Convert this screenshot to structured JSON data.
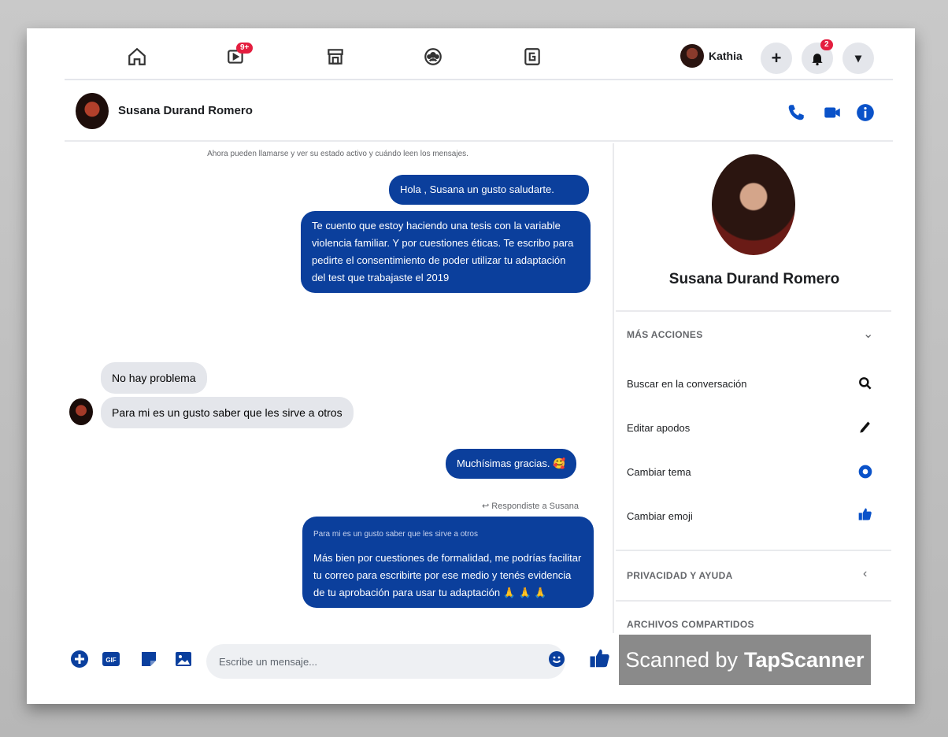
{
  "topnav": {
    "items": [
      {
        "icon": "home-icon"
      },
      {
        "icon": "watch-video-icon",
        "badge": "9+"
      },
      {
        "icon": "marketplace-icon"
      },
      {
        "icon": "groups-icon"
      },
      {
        "icon": "gaming-icon"
      }
    ],
    "user_name": "Kathia",
    "create_label": "+",
    "notifications_badge": "2",
    "menu_label": "▾"
  },
  "conversation": {
    "contact_name": "Susana Durand Romero",
    "system_note": "Ahora pueden llamarse y ver su estado activo y cuándo leen los mensajes.",
    "messages": [
      {
        "from": "me",
        "text": "Hola , Susana un gusto saludarte."
      },
      {
        "from": "me",
        "text": "Te cuento que estoy haciendo una tesis con la variable violencia familiar. Y por cuestiones éticas. Te escribo para pedirte el consentimiento de poder utilizar tu adaptación del test que trabajaste el 2019"
      },
      {
        "from": "them",
        "text": "No hay problema"
      },
      {
        "from": "them",
        "text": "Para mi es un gusto saber que les sirve a otros"
      },
      {
        "from": "me",
        "text": "Muchísimas gracias. 🥰"
      },
      {
        "from": "me",
        "reply_label": "↩ Respondiste a Susana",
        "quote": "Para mi es un gusto saber que les sirve a otros",
        "text": "Más bien por cuestiones de formalidad, me podrías facilitar tu correo para escribirte por ese medio y tenés evidencia de tu aprobación para usar tu adaptación 🙏 🙏 🙏"
      }
    ]
  },
  "side_panel": {
    "profile_name": "Susana Durand Romero",
    "more_actions_title": "MÁS ACCIONES",
    "actions": [
      {
        "label": "Buscar en la conversación",
        "icon": "search-icon"
      },
      {
        "label": "Editar apodos",
        "icon": "pencil-icon"
      },
      {
        "label": "Cambiar tema",
        "icon": "theme-icon"
      },
      {
        "label": "Cambiar emoji",
        "icon": "thumbs-up-icon"
      }
    ],
    "privacy_title": "PRIVACIDAD Y AYUDA",
    "files_title": "ARCHIVOS COMPARTIDOS"
  },
  "composer": {
    "placeholder": "Escribe un mensaje...",
    "gif_label": "GIF"
  },
  "watermark": {
    "prefix": "Scanned by",
    "brand": "TapScanner"
  },
  "colors": {
    "accent": "#0b3f9c",
    "icon_blue": "#0a52c9",
    "badge_red": "#e41e3f"
  }
}
